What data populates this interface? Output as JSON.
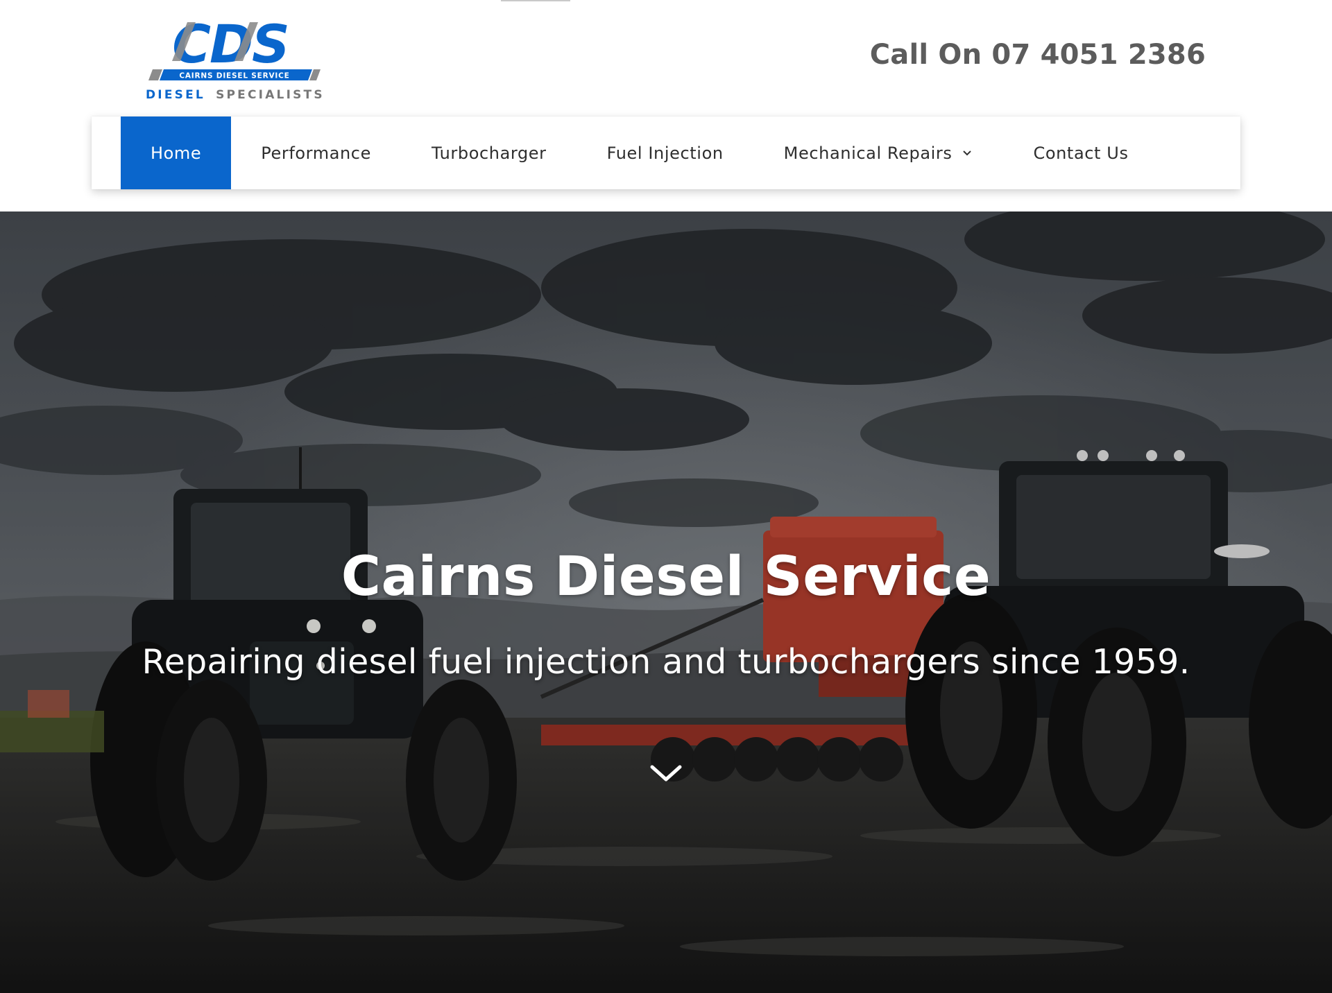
{
  "logo": {
    "letters": "CDS",
    "band_text": "CAIRNS DIESEL SERVICE",
    "tagline_part1": "DIESEL",
    "tagline_part2": "SPECIALISTS",
    "brand_blue": "#0a66cc",
    "brand_grey": "#777777"
  },
  "header": {
    "phone_text": "Call On 07 4051 2386"
  },
  "nav": {
    "items": [
      {
        "label": "Home",
        "active": true
      },
      {
        "label": "Performance"
      },
      {
        "label": "Turbocharger"
      },
      {
        "label": "Fuel Injection"
      },
      {
        "label": "Mechanical Repairs",
        "has_dropdown": true,
        "icon": "chevron-down-icon"
      },
      {
        "label": "Contact Us"
      }
    ],
    "active_color": "#0a66cc"
  },
  "hero": {
    "title": "Cairns Diesel Service",
    "subtitle": "Repairing diesel fuel injection and turbochargers since 1959.",
    "scroll_icon": "chevron-down-icon"
  }
}
